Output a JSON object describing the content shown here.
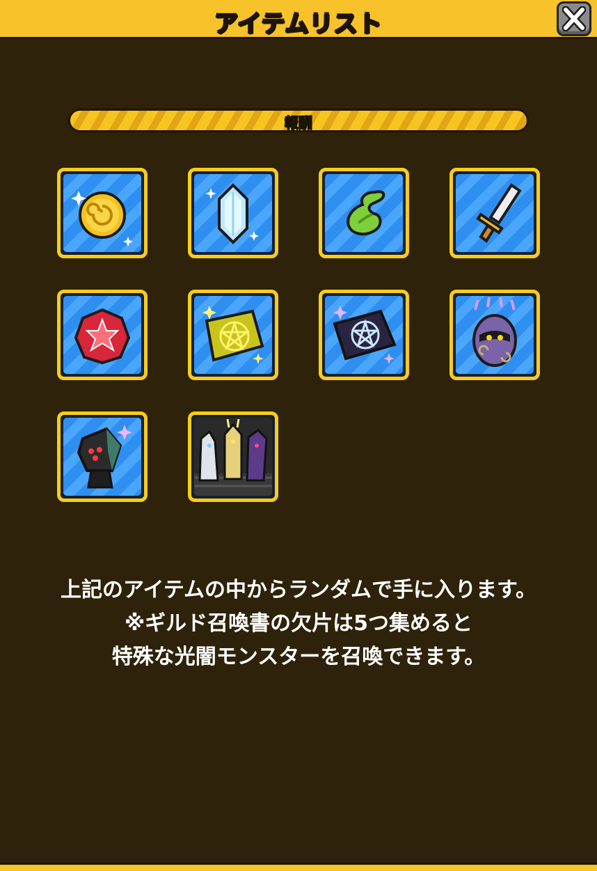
{
  "header": {
    "title": "アイテムリスト",
    "close_icon": "close-icon"
  },
  "section": {
    "label": "報酬"
  },
  "items": [
    {
      "name": "coin-icon"
    },
    {
      "name": "crystal-icon"
    },
    {
      "name": "green-leaf-icon"
    },
    {
      "name": "sword-icon"
    },
    {
      "name": "red-gem-icon"
    },
    {
      "name": "gold-scroll-icon"
    },
    {
      "name": "dark-scroll-icon"
    },
    {
      "name": "purple-egg-icon"
    },
    {
      "name": "cube-head-character-icon"
    },
    {
      "name": "monster-group-icon"
    }
  ],
  "description": {
    "line1": "上記のアイテムの中からランダムで手に入ります。",
    "line2": "※ギルド召喚書の欠片は5つ集めると",
    "line3": "特殊な光闇モンスターを召喚できます。"
  },
  "colors": {
    "header": "#f7c22a",
    "background": "#2e220a",
    "tile_border": "#f6cd1b",
    "tile_fill": "#2e8ff0"
  }
}
